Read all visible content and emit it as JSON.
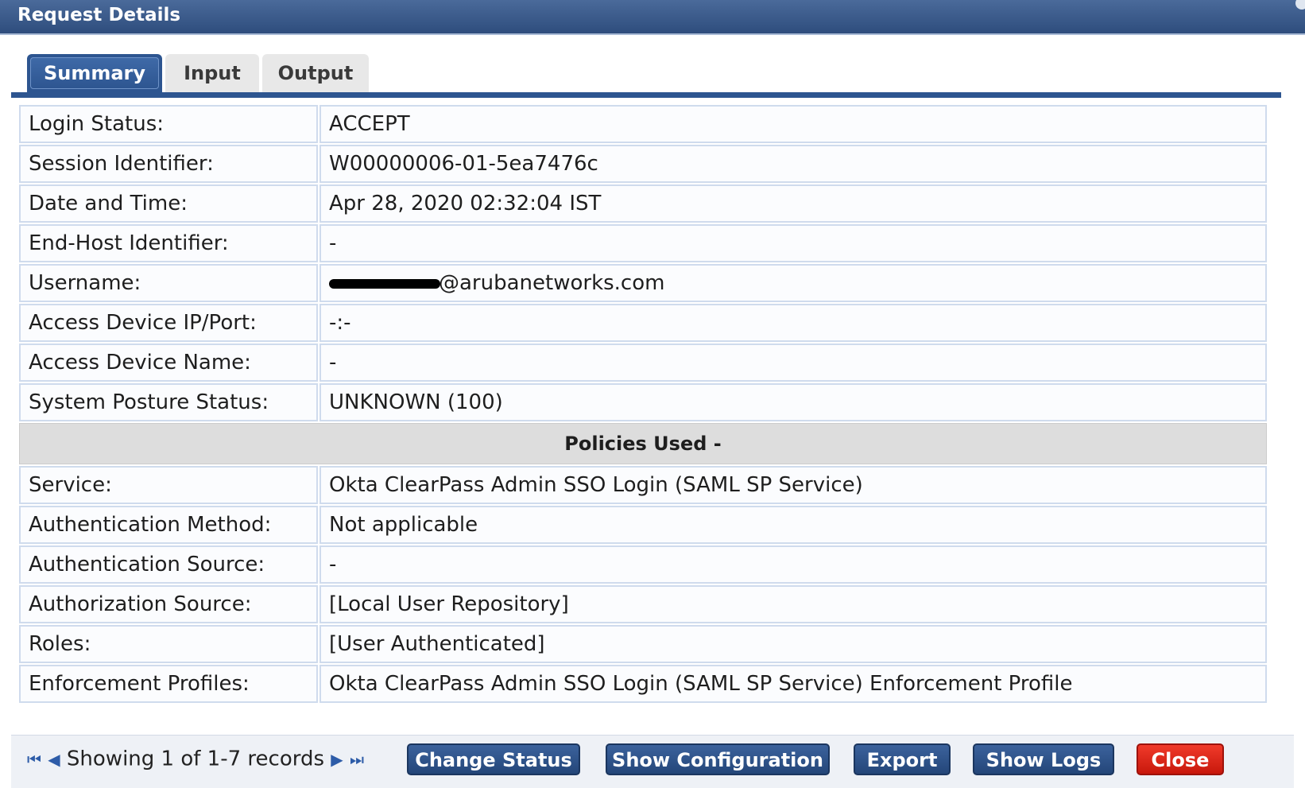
{
  "window": {
    "title": "Request Details"
  },
  "tabs": [
    {
      "label": "Summary",
      "active": true
    },
    {
      "label": "Input",
      "active": false
    },
    {
      "label": "Output",
      "active": false
    }
  ],
  "details": [
    {
      "label": "Login Status:",
      "value": "ACCEPT"
    },
    {
      "label": "Session Identifier:",
      "value": "W00000006-01-5ea7476c"
    },
    {
      "label": "Date and Time:",
      "value": "Apr 28, 2020 02:32:04 IST"
    },
    {
      "label": "End-Host Identifier:",
      "value": "-"
    },
    {
      "label": "Username:",
      "value": "@arubanetworks.com",
      "redacted_prefix": true
    },
    {
      "label": "Access Device IP/Port:",
      "value": "-:-"
    },
    {
      "label": "Access Device Name:",
      "value": "-"
    },
    {
      "label": "System Posture Status:",
      "value": "UNKNOWN (100)"
    }
  ],
  "policies": {
    "header": "Policies Used -",
    "rows": [
      {
        "label": "Service:",
        "value": "Okta ClearPass Admin SSO Login (SAML SP Service)"
      },
      {
        "label": "Authentication Method:",
        "value": "Not applicable"
      },
      {
        "label": "Authentication Source:",
        "value": "-"
      },
      {
        "label": "Authorization Source:",
        "value": "[Local User Repository]"
      },
      {
        "label": "Roles:",
        "value": "[User Authenticated]"
      },
      {
        "label": "Enforcement Profiles:",
        "value": "Okta ClearPass Admin SSO Login (SAML SP Service) Enforcement Profile"
      }
    ]
  },
  "footer": {
    "pager_text": "Showing 1 of 1-7 records",
    "buttons": {
      "change_status": "Change Status",
      "show_configuration": "Show Configuration",
      "export": "Export",
      "show_logs": "Show Logs",
      "close": "Close"
    }
  },
  "colors": {
    "title_bar": "#2e4d7d",
    "tab_active": "#2d5590",
    "button_blue": "#244679",
    "button_close": "#d62416"
  }
}
